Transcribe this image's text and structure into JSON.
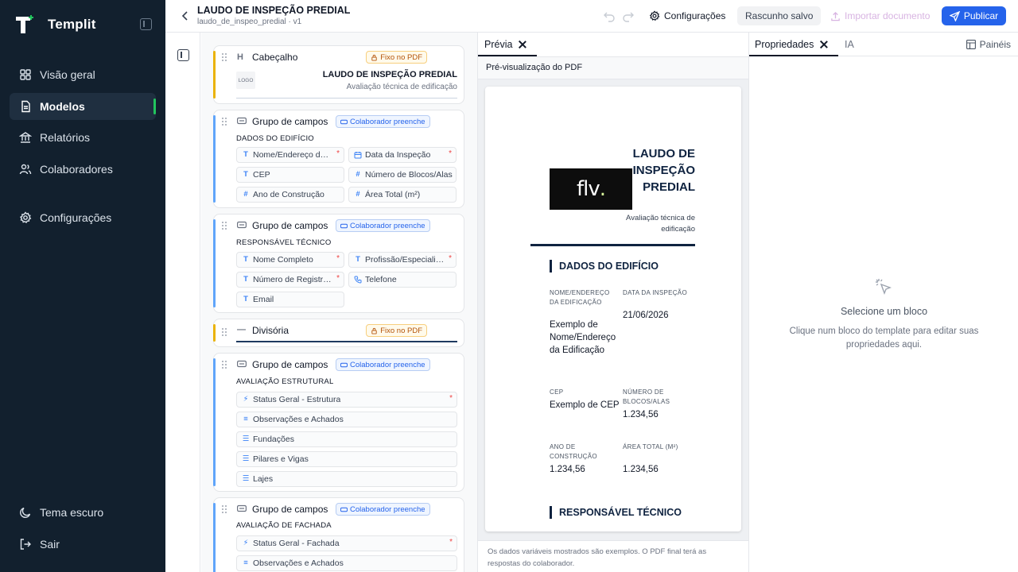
{
  "app": {
    "name": "Templit"
  },
  "nav": {
    "items": [
      {
        "label": "Visão geral",
        "icon": "grid-icon"
      },
      {
        "label": "Modelos",
        "icon": "document-icon",
        "active": true
      },
      {
        "label": "Relatórios",
        "icon": "bank-icon"
      },
      {
        "label": "Colaboradores",
        "icon": "users-icon"
      },
      {
        "label": "Configurações",
        "icon": "gear-icon"
      }
    ],
    "bottom": [
      {
        "label": "Tema escuro",
        "icon": "moon-icon"
      },
      {
        "label": "Sair",
        "icon": "logout-icon"
      }
    ]
  },
  "topbar": {
    "title": "LAUDO DE INSPEÇÃO PREDIAL",
    "subtitle": "laudo_de_inspeo_predial · v1",
    "config_label": "Configurações",
    "draft_label": "Rascunho salvo",
    "import_label": "Importar documento",
    "publish_label": "Publicar"
  },
  "blocks": {
    "header_block": {
      "title": "Cabeçalho",
      "badge": "Fixo no PDF",
      "logo": "LOGO",
      "doc_title": "LAUDO DE INSPEÇÃO PREDIAL",
      "doc_subtitle": "Avaliação técnica de edificação"
    },
    "group1": {
      "title": "Grupo de campos",
      "badge": "Colaborador preenche",
      "section": "DADOS DO EDIFÍCIO",
      "fields": [
        {
          "label": "Nome/Endereço da ...",
          "required": "*"
        },
        {
          "label": "Data da Inspeção",
          "required": "*"
        },
        {
          "label": "CEP",
          "required": ""
        },
        {
          "label": "Número de Blocos/Alas",
          "required": ""
        },
        {
          "label": "Ano de Construção",
          "required": ""
        },
        {
          "label": "Área Total (m²)",
          "required": ""
        }
      ]
    },
    "group2": {
      "title": "Grupo de campos",
      "badge": "Colaborador preenche",
      "section": "RESPONSÁVEL TÉCNICO",
      "fields": [
        {
          "label": "Nome Completo",
          "required": "*"
        },
        {
          "label": "Profissão/Especialid...",
          "required": "*"
        },
        {
          "label": "Número de Registro ...",
          "required": "*"
        },
        {
          "label": "Telefone",
          "required": ""
        },
        {
          "label": "Email",
          "required": ""
        }
      ]
    },
    "divider": {
      "title": "Divisória",
      "badge": "Fixo no PDF"
    },
    "group3": {
      "title": "Grupo de campos",
      "badge": "Colaborador preenche",
      "section": "AVALIAÇÃO ESTRUTURAL",
      "fields": [
        {
          "label": "Status Geral - Estrutura",
          "required": "*"
        },
        {
          "label": "Observações e Achados",
          "required": ""
        },
        {
          "label": "Fundações",
          "required": ""
        },
        {
          "label": "Pilares e Vigas",
          "required": ""
        },
        {
          "label": "Lajes",
          "required": ""
        }
      ]
    },
    "group4": {
      "title": "Grupo de campos",
      "badge": "Colaborador preenche",
      "section": "AVALIAÇÃO DE FACHADA",
      "fields": [
        {
          "label": "Status Geral - Fachada",
          "required": "*"
        },
        {
          "label": "Observações e Achados",
          "required": ""
        }
      ]
    }
  },
  "preview": {
    "tab_label": "Prévia",
    "header": "Pré-visualização do PDF",
    "pdf": {
      "logo_text": "flv",
      "logo_dot": ".",
      "title": "LAUDO DE INSPEÇÃO PREDIAL",
      "subtitle": "Avaliação técnica de edificação",
      "section1": "DADOS DO EDIFÍCIO",
      "fields": [
        {
          "label": "NOME/ENDEREÇO DA EDIFICAÇÃO",
          "value": "Exemplo de Nome/Endereço da Edificação"
        },
        {
          "label": "DATA DA INSPEÇÃO",
          "value": "21/06/2026"
        },
        {
          "label": "CEP",
          "value": "Exemplo de CEP"
        },
        {
          "label": "NÚMERO DE BLOCOS/ALAS",
          "value": "1.234,56"
        },
        {
          "label": "ANO DE CONSTRUÇÃO",
          "value": "1.234,56"
        },
        {
          "label": "ÁREA TOTAL (M²)",
          "value": "1.234,56"
        }
      ],
      "section2": "RESPONSÁVEL TÉCNICO"
    },
    "footer": "Os dados variáveis mostrados são exemplos. O PDF final terá as respostas do colaborador."
  },
  "props": {
    "tab_properties": "Propriedades",
    "tab_ai": "IA",
    "panels_label": "Painéis",
    "empty_title": "Selecione um bloco",
    "empty_desc": "Clique num bloco do template para editar suas propriedades aqui."
  },
  "colors": {
    "sidebar_bg": "#12202e",
    "accent_green": "#22c55e",
    "primary": "#2563eb",
    "pdf_navy": "#0f2340"
  }
}
